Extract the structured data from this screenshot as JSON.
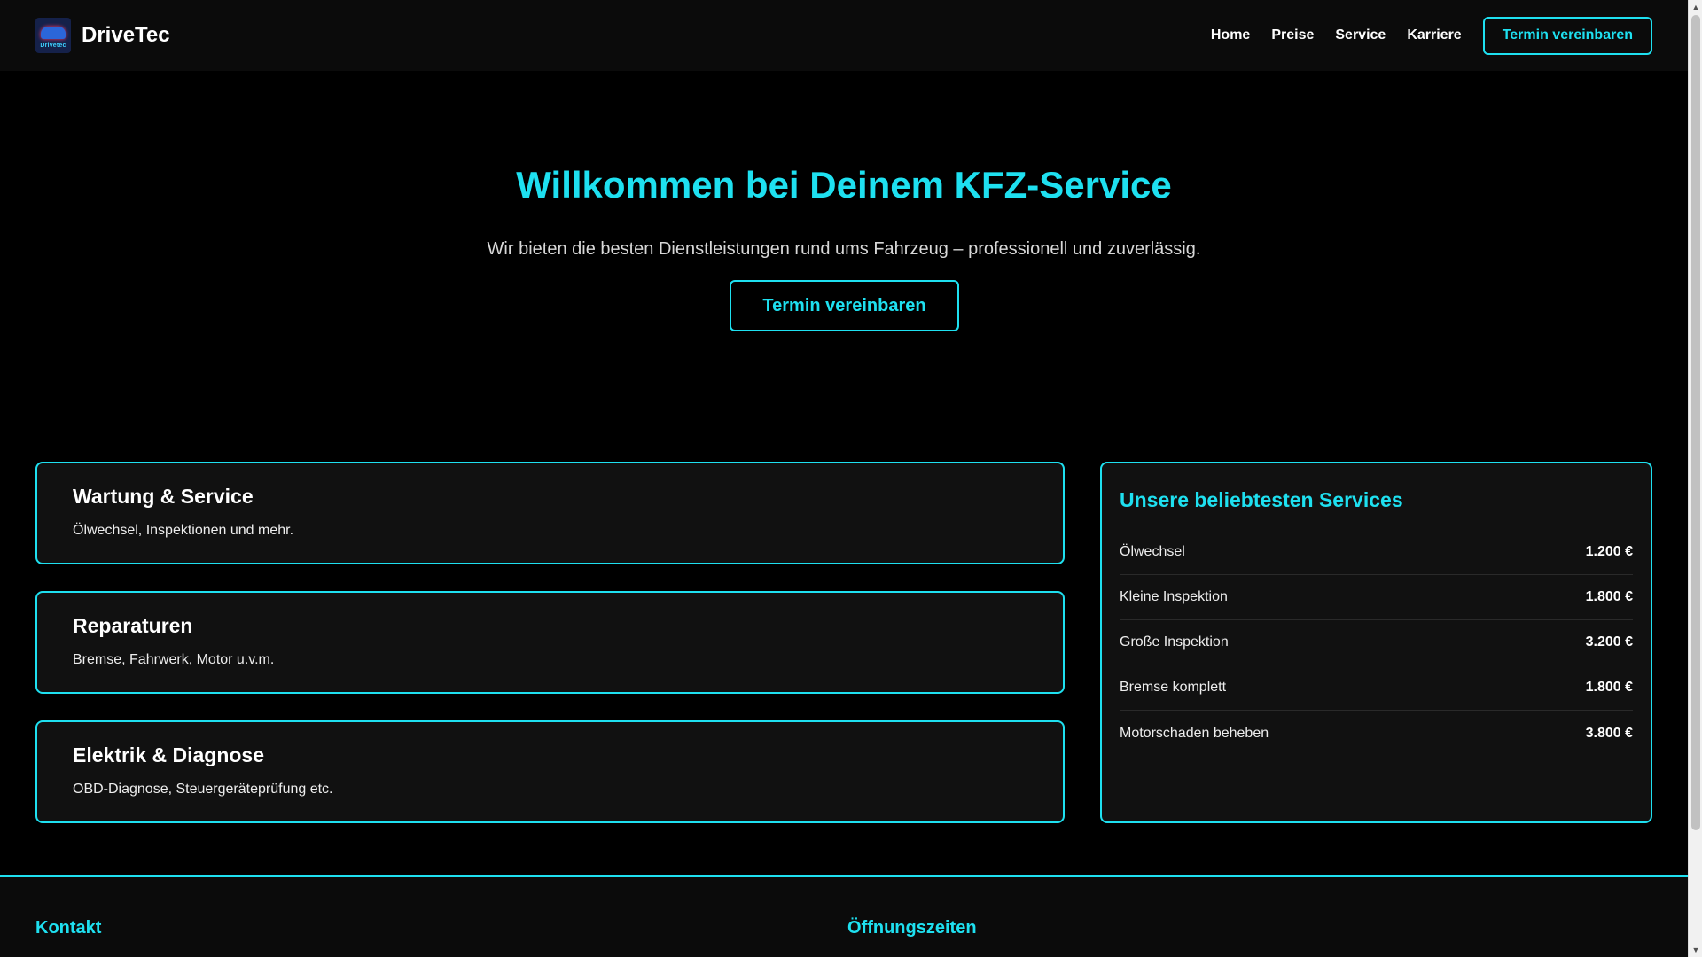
{
  "brand": {
    "logo_text": "Drivetec",
    "name": "DriveTec"
  },
  "nav": {
    "items": [
      {
        "label": "Home"
      },
      {
        "label": "Preise"
      },
      {
        "label": "Service"
      },
      {
        "label": "Karriere"
      }
    ],
    "cta_label": "Termin vereinbaren"
  },
  "hero": {
    "title": "Willkommen bei Deinem KFZ-Service",
    "subtitle": "Wir bieten die besten Dienstleistungen rund ums Fahrzeug – professionell und zuverlässig.",
    "cta_label": "Termin vereinbaren"
  },
  "services": [
    {
      "title": "Wartung & Service",
      "description": "Ölwechsel, Inspektionen und mehr."
    },
    {
      "title": "Reparaturen",
      "description": "Bremse, Fahrwerk, Motor u.v.m."
    },
    {
      "title": "Elektrik & Diagnose",
      "description": "OBD-Diagnose, Steuergeräteprüfung etc."
    }
  ],
  "popular": {
    "title": "Unsere beliebtesten Services",
    "items": [
      {
        "name": "Ölwechsel",
        "price": "1.200 €"
      },
      {
        "name": "Kleine Inspektion",
        "price": "1.800 €"
      },
      {
        "name": "Große Inspektion",
        "price": "3.200 €"
      },
      {
        "name": "Bremse komplett",
        "price": "1.800 €"
      },
      {
        "name": "Motorschaden beheben",
        "price": "3.800 €"
      }
    ]
  },
  "footer": {
    "contact_title": "Kontakt",
    "hours_title": "Öffnungszeiten"
  },
  "colors": {
    "accent": "#1ee0f0",
    "background": "#000000",
    "card_background": "#111111"
  },
  "icons": {
    "logo": "car-logo-icon",
    "scroll_up": "arrow-up-icon",
    "scroll_down": "arrow-down-icon"
  }
}
